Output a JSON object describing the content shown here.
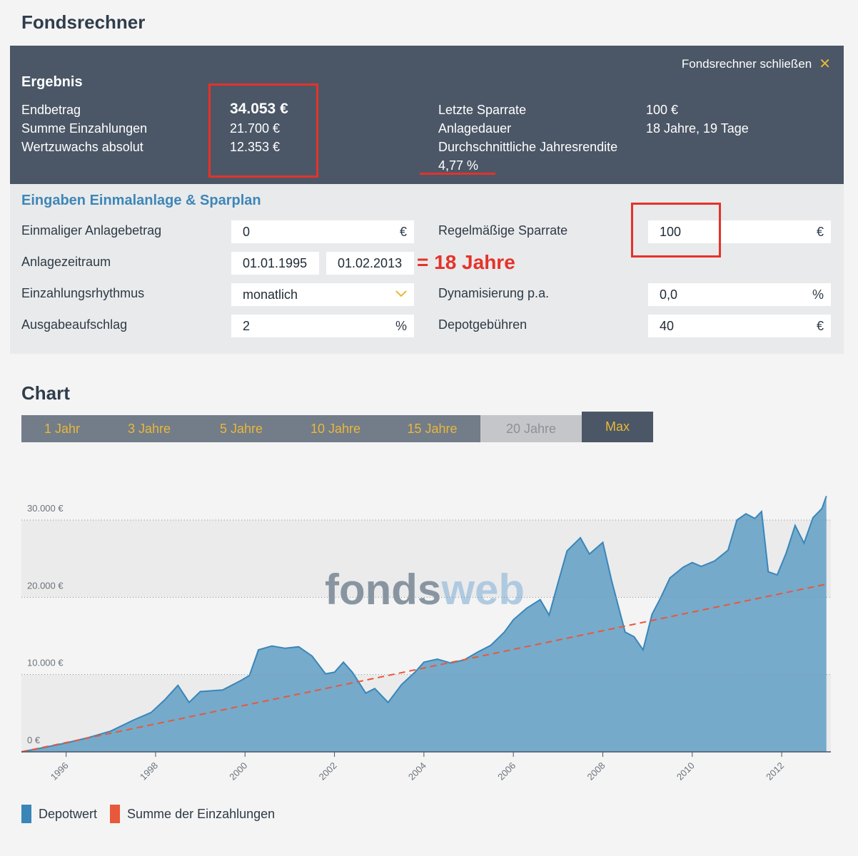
{
  "page": {
    "title": "Fondsrechner"
  },
  "result": {
    "heading": "Ergebnis",
    "close_label": "Fondsrechner schließen",
    "endbetrag_label": "Endbetrag",
    "endbetrag_value": "34.053 €",
    "einzahlungen_label": "Summe Einzahlungen",
    "einzahlungen_value": "21.700 €",
    "wertzuwachs_label": "Wertzuwachs absolut",
    "wertzuwachs_value": "12.353 €",
    "letzte_sparrate_label": "Letzte Sparrate",
    "letzte_sparrate_value": "100 €",
    "anlagedauer_label": "Anlagedauer",
    "anlagedauer_value": "18 Jahre, 19 Tage",
    "rendite_label": "Durchschnittliche Jahresrendite",
    "rendite_value": "4,77 %"
  },
  "inputs": {
    "heading": "Eingaben Einmalanlage & Sparplan",
    "einmal_label": "Einmaliger Anlagebetrag",
    "einmal_value": "0",
    "einmal_unit": "€",
    "zeitraum_label": "Anlagezeitraum",
    "zeitraum_start": "01.01.1995",
    "zeitraum_end": "01.02.2013",
    "rhythmus_label": "Einzahlungsrhythmus",
    "rhythmus_value": "monatlich",
    "aufschlag_label": "Ausgabeaufschlag",
    "aufschlag_value": "2",
    "aufschlag_unit": "%",
    "sparrate_label": "Regelmäßige Sparrate",
    "sparrate_value": "100",
    "sparrate_unit": "€",
    "dynamik_label": "Dynamisierung p.a.",
    "dynamik_value": "0,0",
    "dynamik_unit": "%",
    "depot_label": "Depotgebühren",
    "depot_value": "40",
    "depot_unit": "€"
  },
  "annotation": {
    "text": "= 18 Jahre",
    "color": "#e5322a"
  },
  "chart_section": {
    "title": "Chart",
    "tabs": [
      {
        "label": "1 Jahr",
        "state": "enabled"
      },
      {
        "label": "3 Jahre",
        "state": "enabled"
      },
      {
        "label": "5 Jahre",
        "state": "enabled"
      },
      {
        "label": "10 Jahre",
        "state": "enabled"
      },
      {
        "label": "15 Jahre",
        "state": "enabled"
      },
      {
        "label": "20 Jahre",
        "state": "disabled"
      },
      {
        "label": "Max",
        "state": "active"
      }
    ],
    "watermark": "fondsweb"
  },
  "chart_data": {
    "type": "area",
    "title": "",
    "xlabel": "",
    "ylabel": "",
    "xlim": [
      1995.0,
      2013.1
    ],
    "ylim": [
      0,
      30000
    ],
    "y_ticks": [
      0,
      10000,
      20000,
      30000
    ],
    "y_tick_labels": [
      "0 €",
      "10.000 €",
      "20.000 €",
      "30.000 €"
    ],
    "x_ticks": [
      1996,
      1998,
      2000,
      2002,
      2004,
      2006,
      2008,
      2010,
      2012
    ],
    "x_tick_labels": [
      "1996",
      "1998",
      "2000",
      "2002",
      "2004",
      "2006",
      "2008",
      "2010",
      "2012"
    ],
    "legend_position": "bottom-left",
    "series": [
      {
        "name": "Depotwert",
        "color": "#6fa6c9",
        "x": [
          1995.0,
          1995.5,
          1996.0,
          1996.5,
          1997.0,
          1997.5,
          1997.9,
          1998.2,
          1998.5,
          1998.75,
          1999.0,
          1999.5,
          1999.9,
          2000.1,
          2000.3,
          2000.6,
          2000.9,
          2001.2,
          2001.5,
          2001.8,
          2002.0,
          2002.2,
          2002.4,
          2002.7,
          2002.9,
          2003.2,
          2003.5,
          2003.8,
          2004.0,
          2004.3,
          2004.6,
          2004.9,
          2005.2,
          2005.5,
          2005.8,
          2006.0,
          2006.3,
          2006.6,
          2006.8,
          2007.0,
          2007.2,
          2007.5,
          2007.7,
          2008.0,
          2008.2,
          2008.5,
          2008.7,
          2008.9,
          2009.1,
          2009.3,
          2009.5,
          2009.8,
          2010.0,
          2010.2,
          2010.5,
          2010.8,
          2011.0,
          2011.2,
          2011.4,
          2011.55,
          2011.7,
          2011.9,
          2012.1,
          2012.3,
          2012.5,
          2012.7,
          2012.9,
          2013.0
        ],
        "y": [
          0,
          550,
          1150,
          1850,
          2700,
          4100,
          5100,
          6700,
          8600,
          6400,
          7800,
          8000,
          9200,
          9900,
          13200,
          13700,
          13400,
          13600,
          12400,
          10100,
          10300,
          11600,
          10300,
          7600,
          8200,
          6400,
          8700,
          10300,
          11600,
          12000,
          11500,
          11900,
          12900,
          13800,
          15500,
          17100,
          18600,
          19700,
          17700,
          21900,
          26000,
          27700,
          25600,
          27100,
          22100,
          15500,
          14900,
          13200,
          17800,
          20000,
          22500,
          23900,
          24500,
          24000,
          24700,
          26100,
          30000,
          30800,
          30200,
          31100,
          23300,
          22900,
          25700,
          29300,
          27000,
          30300,
          31500,
          33100
        ]
      },
      {
        "name": "Summe der Einzahlungen",
        "color": "#e8583a",
        "x": [
          1995.0,
          2013.0
        ],
        "y": [
          0,
          21700
        ]
      }
    ]
  }
}
